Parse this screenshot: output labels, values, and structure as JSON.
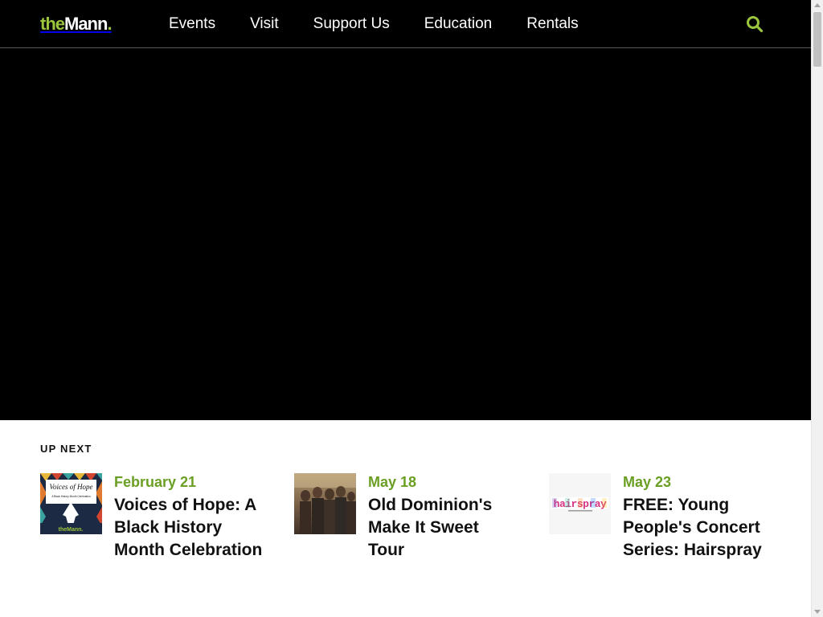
{
  "header": {
    "logo": {
      "the": "the",
      "mann": "Mann",
      "dot": "."
    },
    "nav": [
      "Events",
      "Visit",
      "Support Us",
      "Education",
      "Rentals"
    ],
    "search_icon": "search-icon"
  },
  "colors": {
    "accent_green": "#9bc53d",
    "date_green": "#6a9f23",
    "header_bg": "#000000",
    "hero_bg": "#000000"
  },
  "up_next": {
    "heading": "UP NEXT",
    "events": [
      {
        "date": "February 21",
        "title": "Voices of Hope: A Black History Month Celebration",
        "thumb_text": [
          "Voices of Hope",
          "A Black History Month Celebration",
          "theMann."
        ]
      },
      {
        "date": "May 18",
        "title": "Old Dominion's Make It Sweet Tour"
      },
      {
        "date": "May 23",
        "title": "FREE: Young People's Concert Series: Hairspray",
        "thumb_text": [
          "hairspray"
        ]
      }
    ]
  }
}
